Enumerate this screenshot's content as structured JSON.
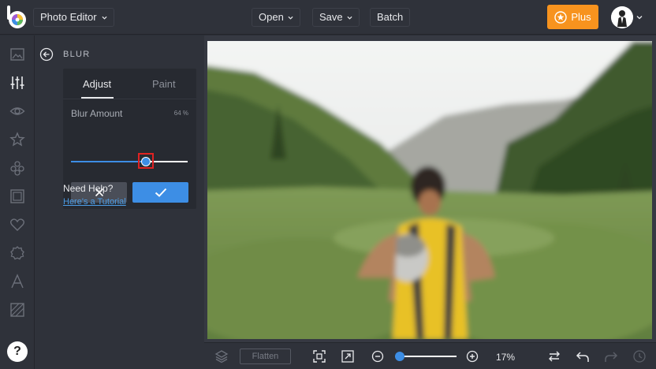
{
  "header": {
    "app_menu_label": "Photo Editor",
    "open_label": "Open",
    "save_label": "Save",
    "batch_label": "Batch",
    "plus_label": "Plus"
  },
  "rail": {
    "items": [
      "image-icon",
      "sliders-icon",
      "eye-icon",
      "star-icon",
      "effects-icon",
      "frame-icon",
      "heart-icon",
      "badge-icon",
      "text-icon",
      "texture-icon"
    ],
    "help_label": "?"
  },
  "panel": {
    "title": "BLUR",
    "tabs": {
      "adjust": "Adjust",
      "paint": "Paint"
    },
    "blur_label": "Blur Amount",
    "blur_value_text": "64 %",
    "blur_value": 0.64,
    "help_title": "Need Help?",
    "help_link": "Here's a Tutorial"
  },
  "bottom": {
    "flatten_label": "Flatten",
    "zoom_label": "17%",
    "zoom_value": 0.08
  },
  "colors": {
    "accent": "#3d8ee5",
    "plus": "#f7931e",
    "focus": "#e02222"
  }
}
